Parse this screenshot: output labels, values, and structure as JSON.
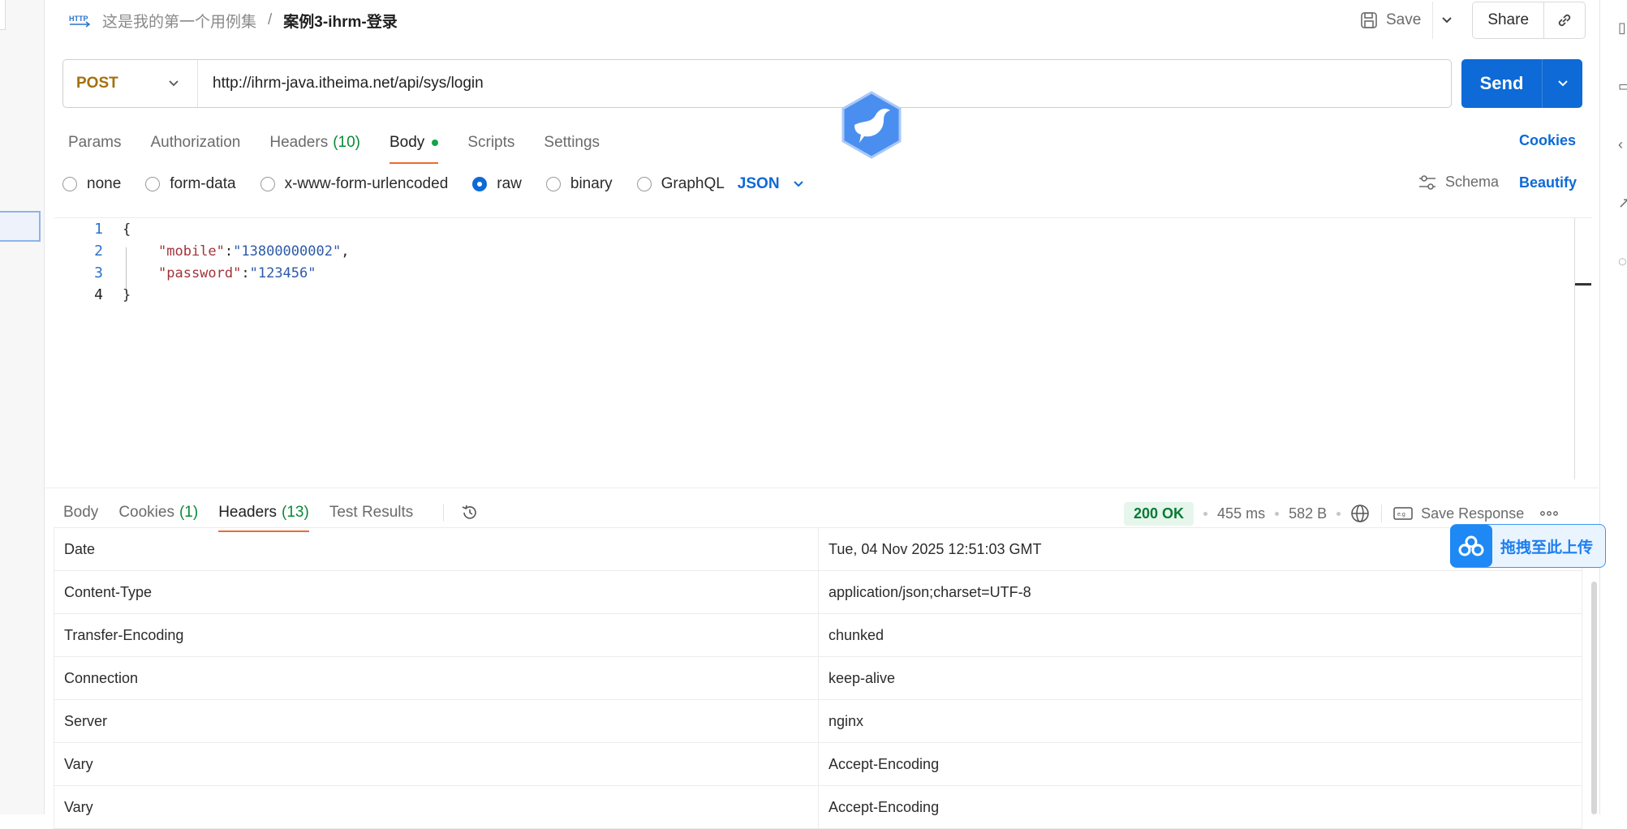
{
  "breadcrumb": {
    "icon": "http-icon",
    "parent": "这是我的第一个用例集",
    "separator": "/",
    "current": "案例3-ihrm-登录"
  },
  "toolbar": {
    "save_label": "Save",
    "share_label": "Share"
  },
  "request": {
    "method": "POST",
    "url": "http://ihrm-java.itheima.net/api/sys/login",
    "send_label": "Send"
  },
  "request_tabs": [
    {
      "label": "Params"
    },
    {
      "label": "Authorization"
    },
    {
      "label": "Headers",
      "count": "(10)"
    },
    {
      "label": "Body",
      "active": true
    },
    {
      "label": "Scripts"
    },
    {
      "label": "Settings"
    }
  ],
  "cookies_label": "Cookies",
  "body_types": [
    {
      "label": "none",
      "selected": false
    },
    {
      "label": "form-data",
      "selected": false
    },
    {
      "label": "x-www-form-urlencoded",
      "selected": false
    },
    {
      "label": "raw",
      "selected": true
    },
    {
      "label": "binary",
      "selected": false
    },
    {
      "label": "GraphQL",
      "selected": false
    }
  ],
  "body_format": "JSON",
  "schema_label": "Schema",
  "beautify_label": "Beautify",
  "editor": {
    "line_numbers": [
      "1",
      "2",
      "3",
      "4"
    ],
    "open_brace": "{",
    "key1": "\"mobile\"",
    "colon": ":",
    "val1": "\"13800000002\"",
    "comma": ",",
    "key2": "\"password\"",
    "val2": "\"123456\"",
    "close_brace": "}"
  },
  "response_tabs": [
    {
      "label": "Body"
    },
    {
      "label": "Cookies",
      "count": "(1)"
    },
    {
      "label": "Headers",
      "count": "(13)",
      "active": true
    },
    {
      "label": "Test Results"
    }
  ],
  "response_meta": {
    "status": "200 OK",
    "time": "455 ms",
    "size": "582 B",
    "save_response_label": "Save Response"
  },
  "upload_badge": "拖拽至此上传",
  "response_headers": [
    {
      "key": "Date",
      "value": "Tue, 04 Nov 2025 12:51:03 GMT"
    },
    {
      "key": "Content-Type",
      "value": "application/json;charset=UTF-8"
    },
    {
      "key": "Transfer-Encoding",
      "value": "chunked"
    },
    {
      "key": "Connection",
      "value": "keep-alive"
    },
    {
      "key": "Server",
      "value": "nginx"
    },
    {
      "key": "Vary",
      "value": "Accept-Encoding"
    },
    {
      "key": "Vary",
      "value": "Accept-Encoding"
    }
  ],
  "colors": {
    "accent_blue": "#0d6ad6",
    "tab_underline": "#ee6b2f",
    "method_post": "#a5710b",
    "status_ok": "#0a7a34"
  }
}
